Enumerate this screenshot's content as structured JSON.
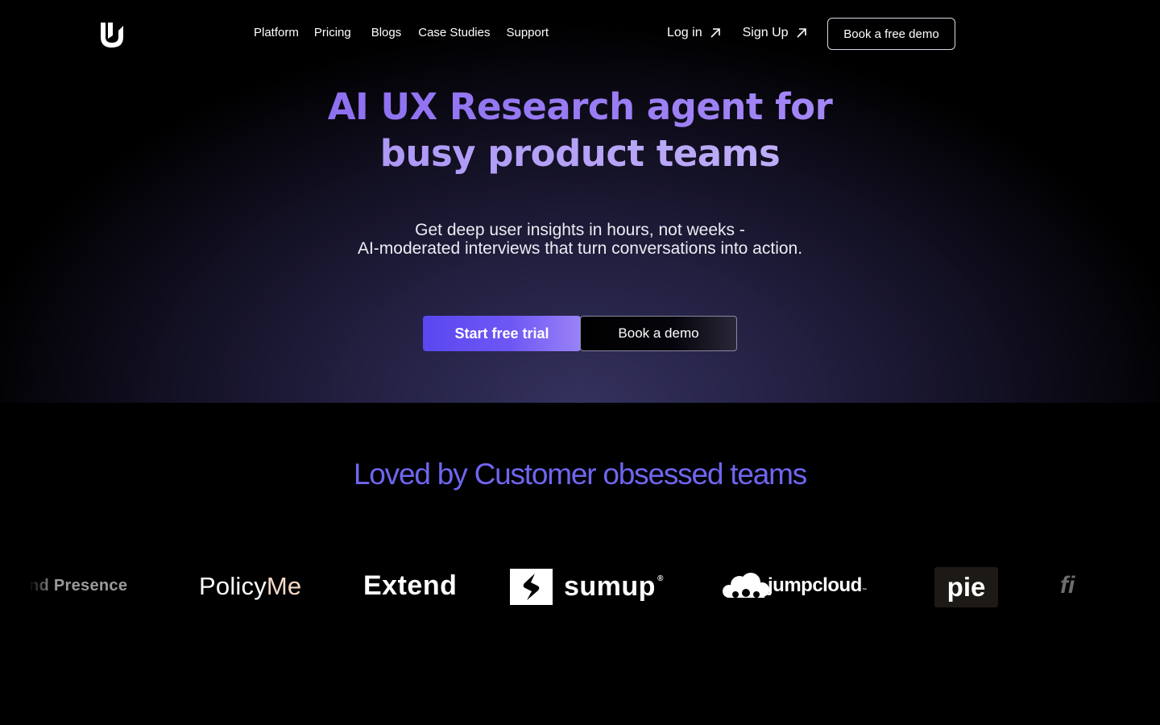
{
  "nav": {
    "links": [
      "Platform",
      "Pricing",
      "Blogs",
      "Case Studies",
      "Support"
    ],
    "login_label": "Log in",
    "signup_label": "Sign Up",
    "demo_label": "Book a free demo"
  },
  "hero": {
    "headline_line1": "AI UX Research agent for",
    "headline_line2": "busy product teams",
    "sub_line1": "Get deep user insights in hours, not weeks -",
    "sub_line2": "AI-moderated interviews that turn conversations into action.",
    "cta_primary": "Start free trial",
    "cta_secondary": "Book a demo"
  },
  "social_proof": {
    "title": "Loved by Customer obsessed teams",
    "logos": {
      "presence_partial": "nd Presence",
      "policyme_a": "Policy",
      "policyme_b": "Me",
      "extend": "Extend",
      "sumup": "sumup",
      "sumup_mark": "®",
      "jumpcloud": "jumpcloud",
      "jumpcloud_mark": "™",
      "pie": "pie",
      "fi": "fi"
    }
  },
  "colors": {
    "accent": "#6f66ef",
    "headline_purple": "#8e70f2",
    "headline_lavender": "#b39cf7",
    "cta_gradient_start": "#5b47f0",
    "cta_gradient_end": "#9a82f7"
  },
  "icons": [
    "logo-icon",
    "arrow-up-right-icon",
    "sumup-mark-icon",
    "jumpcloud-cloud-icon"
  ]
}
